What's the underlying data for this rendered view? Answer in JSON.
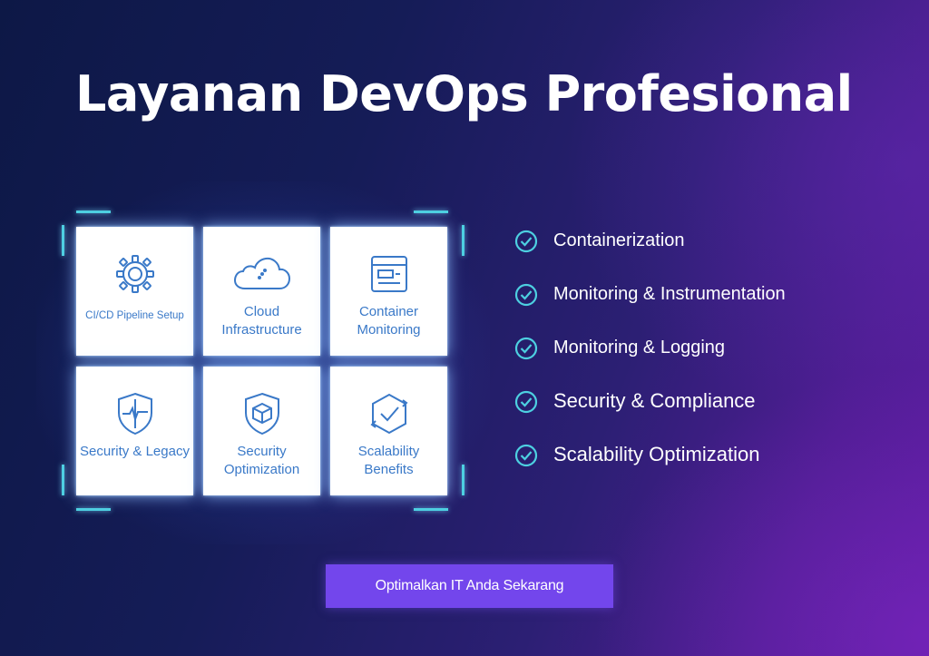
{
  "page": {
    "title": "Layanan DevOps Profesional"
  },
  "services": [
    {
      "label": "CI/CD Pipeline Setup",
      "icon": "gear-icon"
    },
    {
      "label": "Cloud Infrastructure",
      "icon": "cloud-icon"
    },
    {
      "label": "Container Monitoring",
      "icon": "container-window-icon"
    },
    {
      "label": "Security & Legacy",
      "icon": "shield-pulse-icon"
    },
    {
      "label": "Security Optimization",
      "icon": "shield-box-icon"
    },
    {
      "label": "Scalability Benefits",
      "icon": "cycle-check-icon"
    }
  ],
  "features": [
    {
      "text": "Containerization",
      "icon": "check-circle-icon"
    },
    {
      "text": "Monitoring & Instrumentation",
      "icon": "check-circle-icon"
    },
    {
      "text": "Monitoring & Logging",
      "icon": "check-circle-icon"
    },
    {
      "text": "Security & Compliance",
      "icon": "check-circle-icon"
    },
    {
      "text": "Scalability Optimization",
      "icon": "check-circle-icon"
    }
  ],
  "cta": {
    "label": "Optimalkan IT Anda Sekarang"
  },
  "colors": {
    "accent_cyan": "#4dd0e1",
    "icon_blue": "#3a79c8",
    "button_purple": "#7346ec",
    "bg_navy": "#0d1846",
    "bg_purple": "#5d1ca1"
  }
}
